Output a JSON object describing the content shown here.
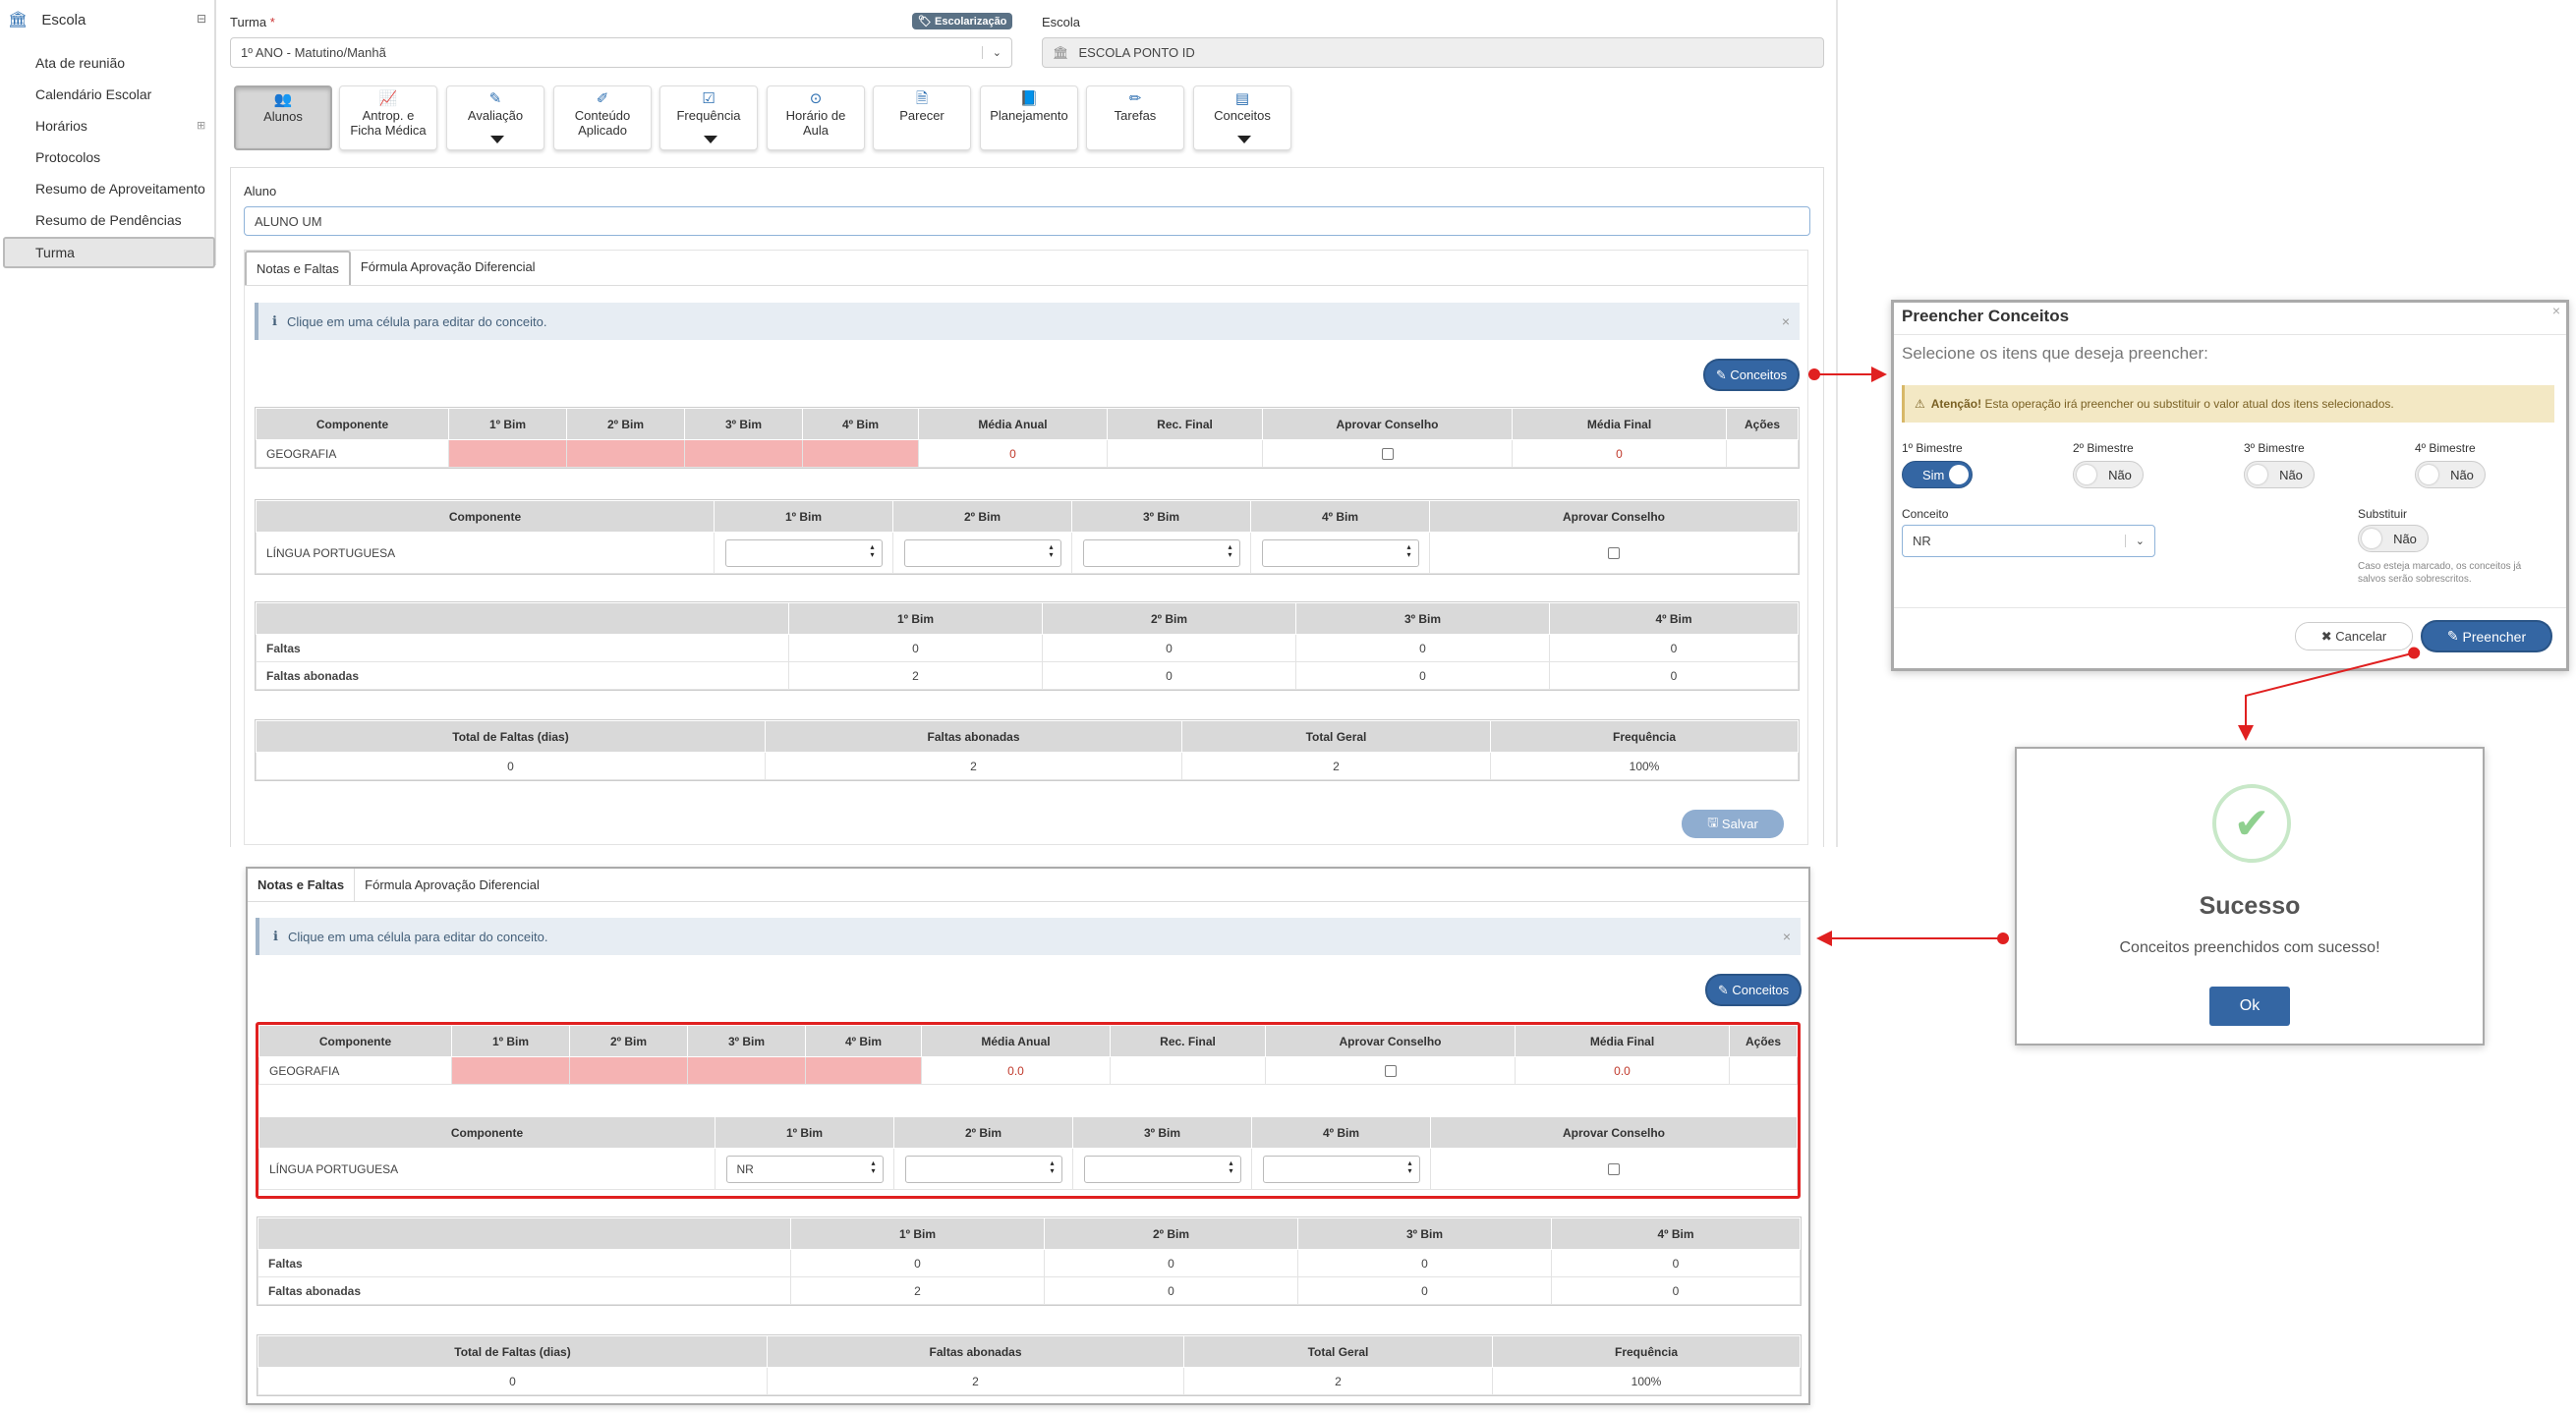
{
  "sidebar": {
    "title": "Escola",
    "items": [
      "Ata de reunião",
      "Calendário Escolar",
      "Horários",
      "Protocolos",
      "Resumo de Aproveitamento",
      "Resumo de Pendências",
      "Turma"
    ]
  },
  "form": {
    "turma_label": "Turma",
    "required_mark": "*",
    "turma_value": "1º ANO - Matutino/Manhã",
    "escolarizacao_tag": "Escolarização",
    "escola_label": "Escola",
    "escola_value": "ESCOLA PONTO ID"
  },
  "toolbar": [
    {
      "l1": "Alunos",
      "l2": "",
      "icon": "users-icon",
      "glyph": "👥"
    },
    {
      "l1": "Antrop. e",
      "l2": "Ficha Médica",
      "icon": "chart-icon",
      "glyph": "📈"
    },
    {
      "l1": "Avaliação",
      "l2": "",
      "icon": "edit-icon",
      "glyph": "✎"
    },
    {
      "l1": "Conteúdo",
      "l2": "Aplicado",
      "icon": "wand-icon",
      "glyph": "✐"
    },
    {
      "l1": "Frequência",
      "l2": "",
      "icon": "checkbox-icon",
      "glyph": "☑"
    },
    {
      "l1": "Horário de",
      "l2": "Aula",
      "icon": "clock-icon",
      "glyph": "⊙"
    },
    {
      "l1": "Parecer",
      "l2": "",
      "icon": "file-icon",
      "glyph": "🗎"
    },
    {
      "l1": "Planejamento",
      "l2": "",
      "icon": "book-icon",
      "glyph": "📘"
    },
    {
      "l1": "Tarefas",
      "l2": "",
      "icon": "pencil-icon",
      "glyph": "✏"
    },
    {
      "l1": "Conceitos",
      "l2": "",
      "icon": "list-icon",
      "glyph": "▤"
    }
  ],
  "aluno": {
    "label": "Aluno",
    "value": "ALUNO UM"
  },
  "tabs": [
    "Notas e Faltas",
    "Fórmula Aprovação Diferencial"
  ],
  "info_text": "Clique em uma célula para editar do conceito.",
  "conceitos_button": "Conceitos",
  "salvar_button": "Salvar",
  "table1": {
    "headers": [
      "Componente",
      "1º Bim",
      "2º Bim",
      "3º Bim",
      "4º Bim",
      "Média Anual",
      "Rec. Final",
      "Aprovar Conselho",
      "Média Final",
      "Ações"
    ],
    "row_name": "GEOGRAFIA",
    "media_top": "0",
    "media_bottom": "0.0"
  },
  "table2": {
    "headers": [
      "Componente",
      "1º Bim",
      "2º Bim",
      "3º Bim",
      "4º Bim",
      "Aprovar Conselho"
    ],
    "row_name": "LÍNGUA PORTUGUESA",
    "bim1_after": "NR"
  },
  "table3": {
    "headers": [
      "",
      "1º Bim",
      "2º Bim",
      "3º Bim",
      "4º Bim"
    ],
    "rows": [
      {
        "name": "Faltas",
        "values": [
          "0",
          "0",
          "0",
          "0"
        ]
      },
      {
        "name": "Faltas abonadas",
        "values": [
          "2",
          "0",
          "0",
          "0"
        ]
      }
    ]
  },
  "table4": {
    "headers": [
      "Total de Faltas (dias)",
      "Faltas abonadas",
      "Total Geral",
      "Frequência"
    ],
    "values": [
      "0",
      "2",
      "2",
      "100%"
    ]
  },
  "modal": {
    "title": "Preencher Conceitos",
    "subtitle": "Selecione os itens que deseja preencher:",
    "warning_bold": "Atenção!",
    "warning_text": "Esta operação irá preencher ou substituir o valor atual dos itens selecionados.",
    "bimestres": [
      {
        "label": "1º Bimestre",
        "state": "Sim",
        "on": true
      },
      {
        "label": "2º Bimestre",
        "state": "Não",
        "on": false
      },
      {
        "label": "3º Bimestre",
        "state": "Não",
        "on": false
      },
      {
        "label": "4º Bimestre",
        "state": "Não",
        "on": false
      }
    ],
    "conceito_label": "Conceito",
    "conceito_value": "NR",
    "substituir_label": "Substituir",
    "substituir_state": "Não",
    "substituir_help": "Caso esteja marcado, os conceitos já salvos serão sobrescritos.",
    "cancel_button": "Cancelar",
    "submit_button": "Preencher",
    "close": "×"
  },
  "success": {
    "title": "Sucesso",
    "message": "Conceitos preenchidos com sucesso!",
    "ok_button": "Ok"
  },
  "colors": {
    "accent": "#3466a3",
    "error": "#c0392b",
    "success": "#8fd08f",
    "highlight": "#e02020"
  }
}
